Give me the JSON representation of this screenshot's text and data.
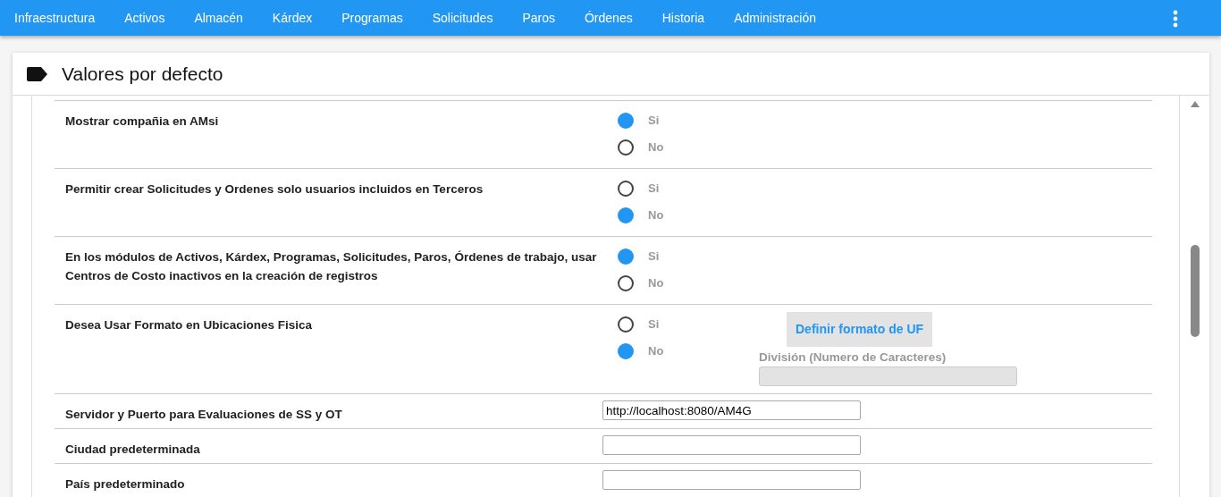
{
  "navbar": {
    "items": [
      {
        "label": "Infraestructura"
      },
      {
        "label": "Activos"
      },
      {
        "label": "Almacén"
      },
      {
        "label": "Kárdex"
      },
      {
        "label": "Programas"
      },
      {
        "label": "Solicitudes"
      },
      {
        "label": "Paros"
      },
      {
        "label": "Órdenes"
      },
      {
        "label": "Historia"
      },
      {
        "label": "Administración"
      }
    ]
  },
  "panel": {
    "title": "Valores por defecto"
  },
  "settings": [
    {
      "kind": "radio",
      "label": "Mostrar compañia en AMsi",
      "options": [
        {
          "label": "Si",
          "selected": true
        },
        {
          "label": "No",
          "selected": false
        }
      ]
    },
    {
      "kind": "radio",
      "label": "Permitir crear Solicitudes y Ordenes solo usuarios incluidos en Terceros",
      "options": [
        {
          "label": "Si",
          "selected": false
        },
        {
          "label": "No",
          "selected": true
        }
      ]
    },
    {
      "kind": "radio",
      "label": "En los módulos de Activos, Kárdex, Programas, Solicitudes, Paros, Órdenes de trabajo, usar Centros de Costo inactivos en la creación de registros",
      "options": [
        {
          "label": "Si",
          "selected": true
        },
        {
          "label": "No",
          "selected": false
        }
      ]
    },
    {
      "kind": "radio",
      "label": "Desea Usar Formato en Ubicaciones Fisica",
      "options": [
        {
          "label": "Si",
          "selected": false
        },
        {
          "label": "No",
          "selected": true
        }
      ],
      "extra": {
        "button": "Definir formato de UF",
        "field_label": "División (Numero de Caracteres)",
        "field_disabled": true
      }
    },
    {
      "kind": "text",
      "label": "Servidor y Puerto para Evaluaciones de SS y OT",
      "value": "http://localhost:8080/AM4G"
    },
    {
      "kind": "text",
      "label": "Ciudad predeterminada"
    },
    {
      "kind": "text",
      "label": "País predeterminado"
    }
  ]
}
